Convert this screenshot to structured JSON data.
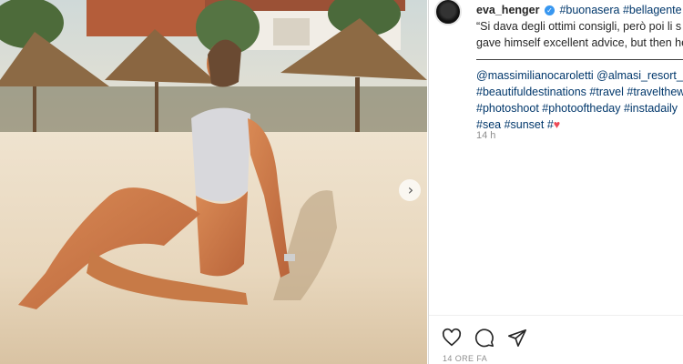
{
  "post": {
    "username": "eva_henger",
    "caption_lines": [
      "#buonasera #bellagente #",
      "“Si dava degli ottimi consigli, però poi li s",
      "gave himself excellent advice, but then he",
      "———————————————————. P",
      "@massimilianocaroletti @almasi_resort_c",
      "#beautifuldestinations #travel #travelthew",
      "#photoshoot #photooftheday #instadaily",
      "#sea #sunset #"
    ],
    "comment_time": "14 h",
    "date": "14 ORE FA"
  },
  "icons": {
    "verified": "verified-badge-icon",
    "heart": "heart-icon",
    "comment": "comment-icon",
    "share": "share-icon",
    "next": "chevron-right-icon"
  },
  "colors": {
    "link": "#00376b",
    "muted": "#8e8e8e",
    "verified": "#3897f0",
    "heart": "#ed4956"
  }
}
